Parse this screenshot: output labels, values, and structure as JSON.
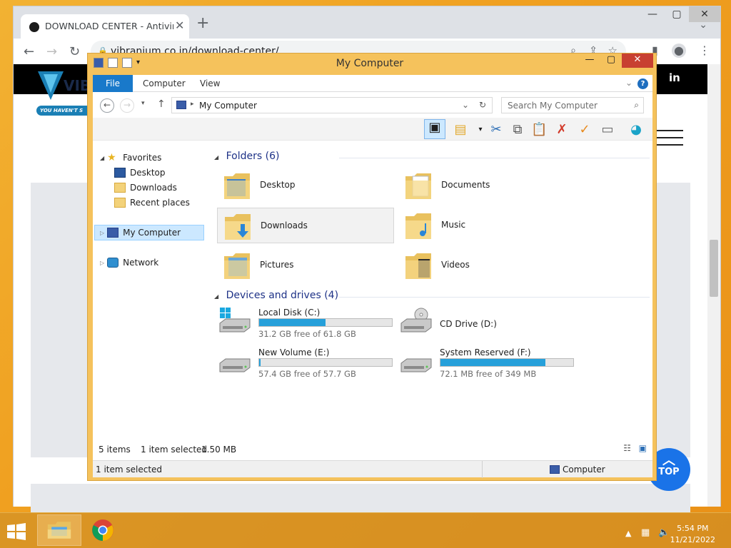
{
  "browser": {
    "tab_title": "DOWNLOAD CENTER - Antivirus",
    "url": "vibranium.co.in/download-center/",
    "page": {
      "logo_text": "VIB",
      "slogan": "YOU HAVEN'T S",
      "social": "in",
      "top_button": "TOP"
    }
  },
  "explorer": {
    "title": "My Computer",
    "ribbon_tabs": [
      "File",
      "Computer",
      "View"
    ],
    "address": "My Computer",
    "search_placeholder": "Search My Computer",
    "nav": {
      "favorites": "Favorites",
      "desktop": "Desktop",
      "downloads": "Downloads",
      "recent": "Recent places",
      "my_computer": "My Computer",
      "network": "Network"
    },
    "folders_header": "Folders (6)",
    "folders": [
      "Desktop",
      "Documents",
      "Downloads",
      "Music",
      "Pictures",
      "Videos"
    ],
    "devices_header": "Devices and drives (4)",
    "drives": [
      {
        "name": "Local Disk (C:)",
        "free": "31.2 GB free of 61.8 GB",
        "used_fraction": 0.5
      },
      {
        "name": "CD Drive (D:)",
        "free": "",
        "used_fraction": null
      },
      {
        "name": "New Volume (E:)",
        "free": "57.4 GB free of 57.7 GB",
        "used_fraction": 0.01
      },
      {
        "name": "System Reserved (F:)",
        "free": "72.1 MB free of 349 MB",
        "used_fraction": 0.79
      }
    ],
    "status": {
      "items": "5 items",
      "selected": "1 item selected",
      "size": "1.50 MB"
    },
    "statusbar": {
      "left": "1 item selected",
      "right": "Computer"
    }
  },
  "taskbar": {
    "time": "5:54 PM",
    "date": "11/21/2022"
  },
  "colors": {
    "accent": "#1979ca",
    "drive_bar": "#26a0da",
    "taskbar": "#e9a53a"
  }
}
